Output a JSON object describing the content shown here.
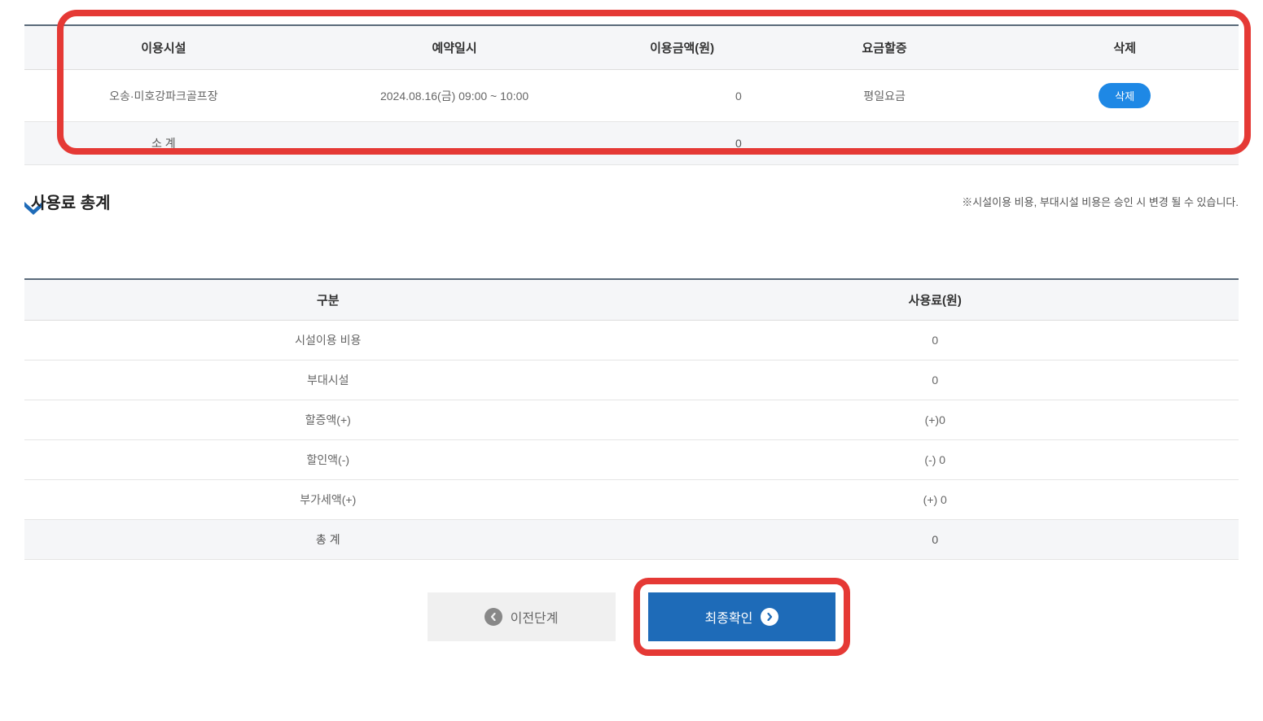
{
  "reservationTable": {
    "headers": {
      "facility": "이용시설",
      "datetime": "예약일시",
      "amount": "이용금액(원)",
      "rateType": "요금할증",
      "delete": "삭제"
    },
    "row": {
      "facility": "오송·미호강파크골프장",
      "datetime": "2024.08.16(금) 09:00 ~ 10:00",
      "amount": "0",
      "rateType": "평일요금",
      "deleteLabel": "삭제"
    },
    "subtotal": {
      "label": "소 계",
      "amount": "0"
    }
  },
  "sectionTitle": "사용료 총계",
  "sectionNote": "※시설이용 비용, 부대시설 비용은 승인 시 변경 될 수 있습니다.",
  "feeTable": {
    "headers": {
      "category": "구분",
      "fee": "사용료(원)"
    },
    "rows": [
      {
        "category": "시설이용 비용",
        "fee": "0"
      },
      {
        "category": "부대시설",
        "fee": "0"
      },
      {
        "category": "할증액(+)",
        "fee": "(+)0"
      },
      {
        "category": "할인액(-)",
        "fee": "(-) 0"
      },
      {
        "category": "부가세액(+)",
        "fee": "(+) 0"
      }
    ],
    "total": {
      "label": "총 계",
      "fee": "0"
    }
  },
  "buttons": {
    "prev": "이전단계",
    "confirm": "최종확인"
  }
}
